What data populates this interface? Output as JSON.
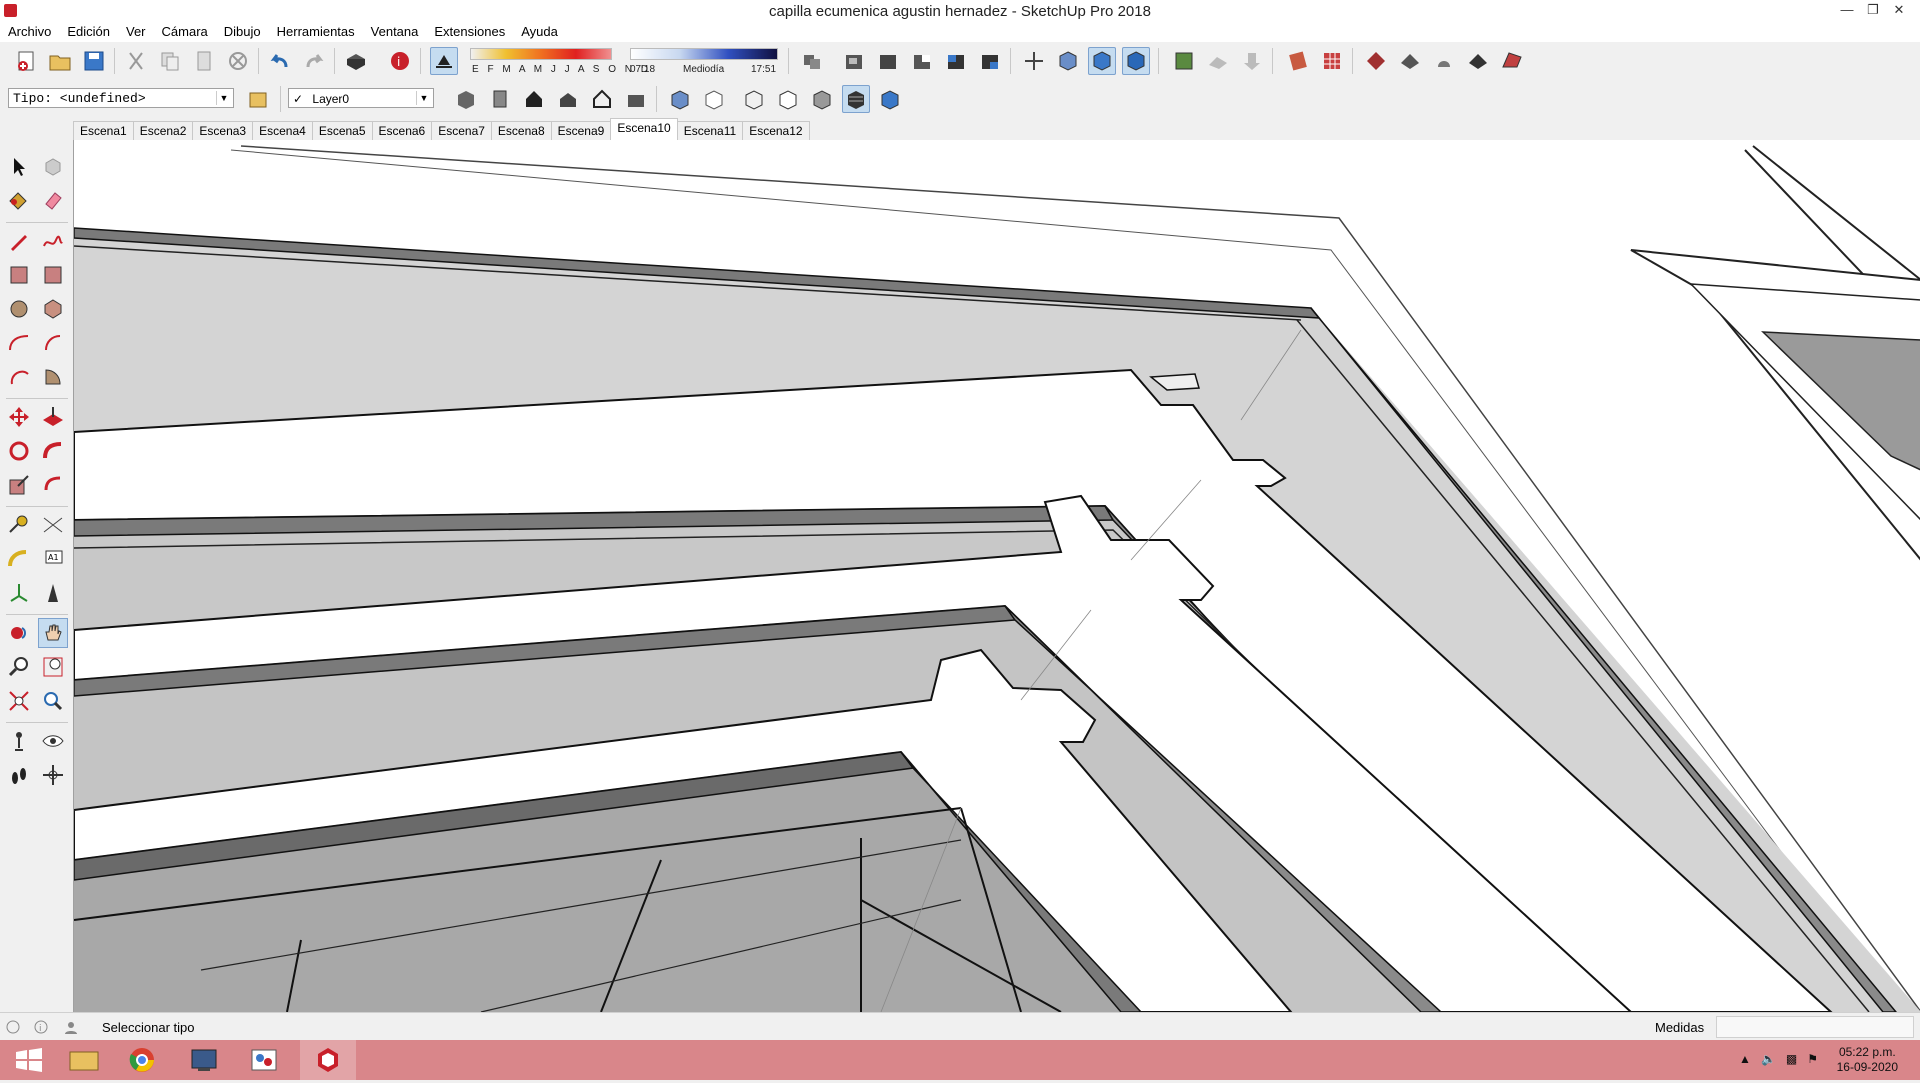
{
  "window": {
    "title": "capilla ecumenica agustin hernadez - SketchUp Pro 2018"
  },
  "menu": [
    "Archivo",
    "Edición",
    "Ver",
    "Cámara",
    "Dibujo",
    "Herramientas",
    "Ventana",
    "Extensiones",
    "Ayuda"
  ],
  "shadows": {
    "months": "E F M A M J J A S O N D",
    "time_start": "07:18",
    "time_mid": "Mediodía",
    "time_end": "17:51"
  },
  "toolbar2": {
    "tipo_value": "Tipo: <undefined>",
    "layer_value": "Layer0",
    "layer_check": "✓"
  },
  "scenes": [
    "Escena1",
    "Escena2",
    "Escena3",
    "Escena4",
    "Escena5",
    "Escena6",
    "Escena7",
    "Escena8",
    "Escena9",
    "Escena10",
    "Escena11",
    "Escena12"
  ],
  "active_scene": "Escena10",
  "status": {
    "text": "Seleccionar tipo",
    "measure_label": "Medidas",
    "measure_value": ""
  },
  "taskbar": {
    "time": "05:22 p.m.",
    "date": "16-09-2020"
  },
  "colors": {
    "taskbar": "#d9868a",
    "accent": "#c8202a",
    "toolbar": "#f0f0f0"
  }
}
